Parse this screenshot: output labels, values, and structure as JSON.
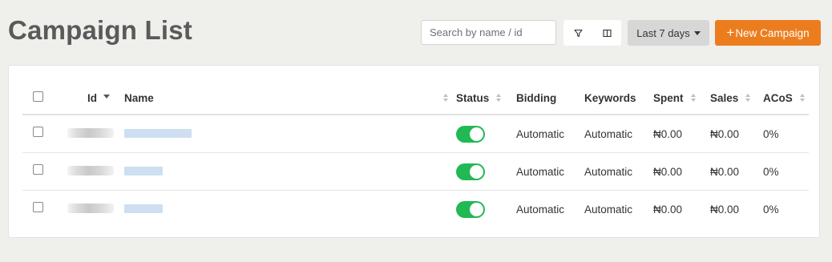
{
  "page": {
    "title": "Campaign List"
  },
  "toolbar": {
    "search_placeholder": "Search by name / id",
    "filter_icon": "filter-icon",
    "columns_icon": "columns-icon",
    "date_range_label": "Last 7 days",
    "new_campaign_plus": "+",
    "new_campaign_label": "New Campaign"
  },
  "colors": {
    "accent": "#ec7d1e",
    "toggle_on": "#20b954",
    "link_placeholder": "#cddff0",
    "background": "#efefec"
  },
  "table": {
    "columns": {
      "id": "Id",
      "name": "Name",
      "status": "Status",
      "bidding": "Bidding",
      "keywords": "Keywords",
      "spent": "Spent",
      "sales": "Sales",
      "acos": "ACoS"
    },
    "rows": [
      {
        "id": "",
        "name": "",
        "status_on": true,
        "bidding": "Automatic",
        "keywords": "Automatic",
        "spent": "₦0.00",
        "sales": "₦0.00",
        "acos": "0%"
      },
      {
        "id": "",
        "name": "",
        "status_on": true,
        "bidding": "Automatic",
        "keywords": "Automatic",
        "spent": "₦0.00",
        "sales": "₦0.00",
        "acos": "0%"
      },
      {
        "id": "",
        "name": "",
        "status_on": true,
        "bidding": "Automatic",
        "keywords": "Automatic",
        "spent": "₦0.00",
        "sales": "₦0.00",
        "acos": "0%"
      }
    ]
  }
}
